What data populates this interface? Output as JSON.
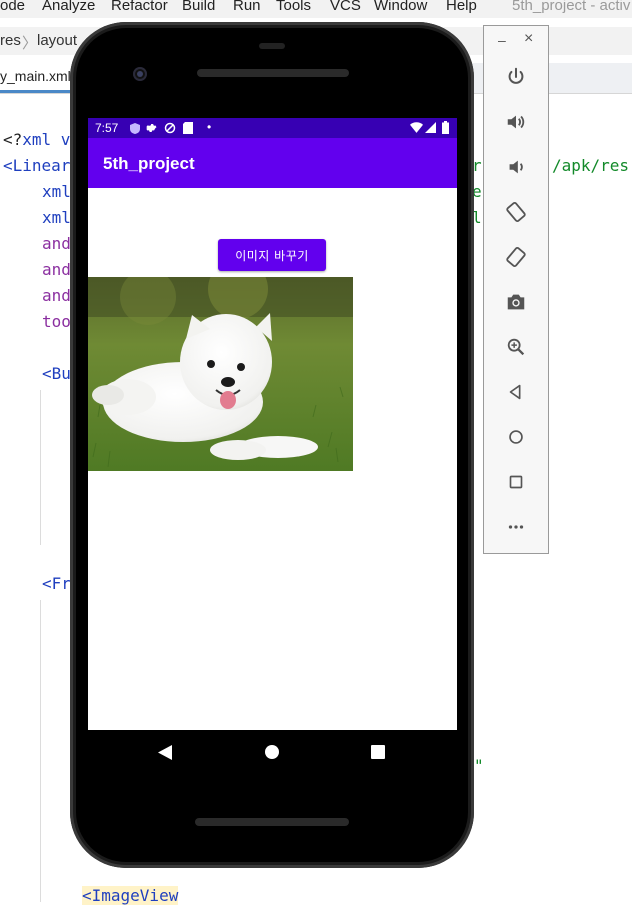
{
  "ide": {
    "menu": [
      "ode",
      "Analyze",
      "Refactor",
      "Build",
      "Run",
      "Tools",
      "VCS",
      "Window",
      "Help"
    ],
    "window_title": "5th_project - activ",
    "breadcrumb": [
      "res",
      "layout"
    ],
    "active_tab": "y_main.xml",
    "code": {
      "line1_a": "<?",
      "line1_b": "xml v",
      "line2": "<Linear",
      "line3": "xml",
      "line4": "xml",
      "line5": "and",
      "line6": "and",
      "line7": "and",
      "line8": "too",
      "line9": "<Bu",
      "line10": "<Fr",
      "line11": "<ImageView",
      "right1": "r",
      "right1b": "/apk/res",
      "right2": "e",
      "right3": "l",
      "right4": "\""
    }
  },
  "emulator_panel": {
    "minimize_label": "–",
    "close_label": "×",
    "buttons": [
      "power-icon",
      "volume-up-icon",
      "volume-down-icon",
      "rotate-left-icon",
      "rotate-right-icon",
      "camera-icon",
      "zoom-icon",
      "back-icon",
      "home-icon",
      "overview-icon",
      "more-icon"
    ]
  },
  "device": {
    "status": {
      "time": "7:57",
      "dot": "•"
    },
    "app_title": "5th_project",
    "button_label": "이미지 바꾸기",
    "image_alt": "white puppy lying on grass"
  },
  "colors": {
    "primary": "#6200ee",
    "primary_dark": "#3700b3"
  }
}
